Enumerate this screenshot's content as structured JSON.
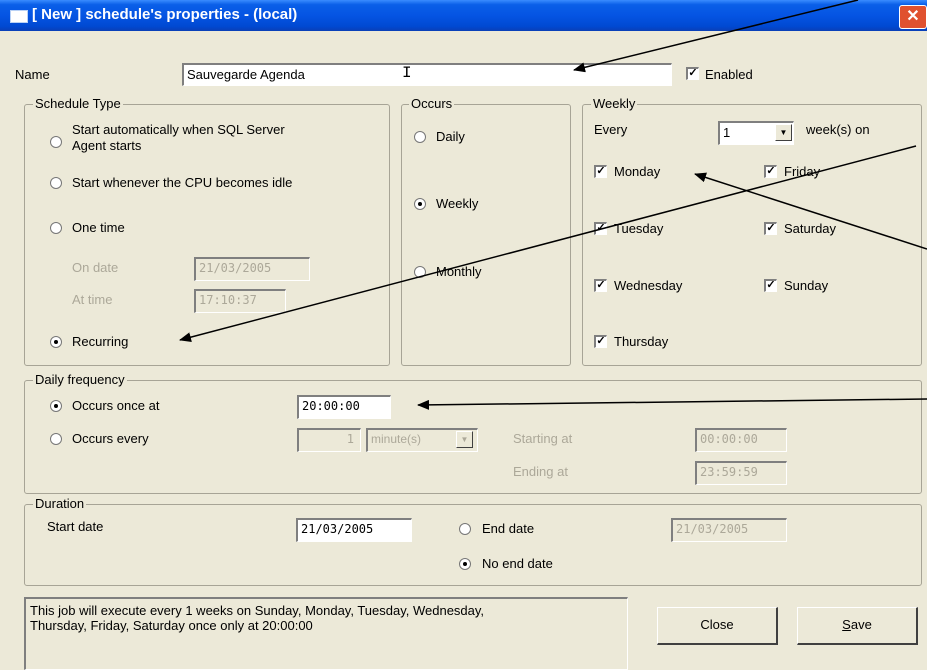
{
  "window": {
    "title": "[ New ] schedule's properties - (local)",
    "close_glyph": "✕"
  },
  "name_row": {
    "label": "Name",
    "value": "Sauvegarde Agenda",
    "enabled_label": "Enabled",
    "enabled_checked": true
  },
  "schedule_type": {
    "legend": "Schedule Type",
    "options": [
      {
        "label_line1": "Start automatically when SQL Server",
        "label_line2": "Agent starts",
        "selected": false
      },
      {
        "label": "Start whenever the CPU becomes idle",
        "selected": false
      },
      {
        "label": "One time",
        "selected": false
      },
      {
        "label": "Recurring",
        "selected": true
      }
    ],
    "on_date_label": "On date",
    "on_date_value": "21/03/2005",
    "at_time_label": "At time",
    "at_time_value": "17:10:37"
  },
  "occurs": {
    "legend": "Occurs",
    "options": [
      {
        "label": "Daily",
        "selected": false
      },
      {
        "label": "Weekly",
        "selected": true
      },
      {
        "label": "Monthly",
        "selected": false
      }
    ]
  },
  "weekly": {
    "legend": "Weekly",
    "every_label": "Every",
    "every_value": "1",
    "weeks_on_label": "week(s) on",
    "days": [
      {
        "label": "Monday",
        "checked": true
      },
      {
        "label": "Tuesday",
        "checked": true
      },
      {
        "label": "Wednesday",
        "checked": true
      },
      {
        "label": "Thursday",
        "checked": true
      },
      {
        "label": "Friday",
        "checked": true
      },
      {
        "label": "Saturday",
        "checked": true
      },
      {
        "label": "Sunday",
        "checked": true
      }
    ]
  },
  "daily_frequency": {
    "legend": "Daily frequency",
    "once_label": "Occurs once at",
    "once_selected": true,
    "once_value": "20:00:00",
    "every_label": "Occurs every",
    "every_selected": false,
    "every_value": "1",
    "every_unit": "minute(s)",
    "starting_label": "Starting at",
    "starting_value": "00:00:00",
    "ending_label": "Ending at",
    "ending_value": "23:59:59"
  },
  "duration": {
    "legend": "Duration",
    "start_label": "Start date",
    "start_value": "21/03/2005",
    "end_label": "End date",
    "end_selected": false,
    "end_value": "21/03/2005",
    "no_end_label": "No end date",
    "no_end_selected": true
  },
  "summary": {
    "line1": "This job will execute every 1 weeks on  Sunday, Monday, Tuesday, Wednesday,",
    "line2": "Thursday, Friday, Saturday once only at 20:00:00"
  },
  "buttons": {
    "close": "Close",
    "save_prefix": "S",
    "save_rest": "ave"
  },
  "colors": {
    "titlebar": "#0554e3",
    "dialog": "#ece9d8",
    "arrow": "#000000"
  },
  "icons": {
    "check": "✓",
    "dropdown": "▼"
  }
}
